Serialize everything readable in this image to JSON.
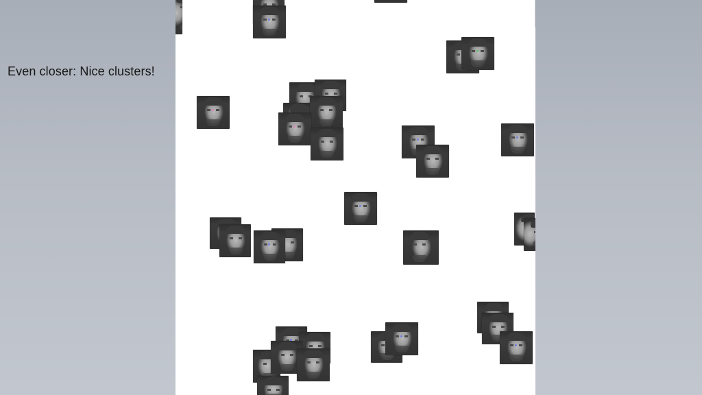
{
  "slide": {
    "caption": "Even closer: Nice clusters!"
  },
  "colors": {
    "side_panel": "#b7bcc5",
    "canvas": "#ffffff",
    "marker_pink": "#e07fbf",
    "marker_blue": "#6f7fe6",
    "marker_green": "#5fc46f"
  },
  "visualization": {
    "type": "embedding-scatter of face image thumbnails",
    "thumbnail_icon": "face-thumbnail-icon"
  }
}
